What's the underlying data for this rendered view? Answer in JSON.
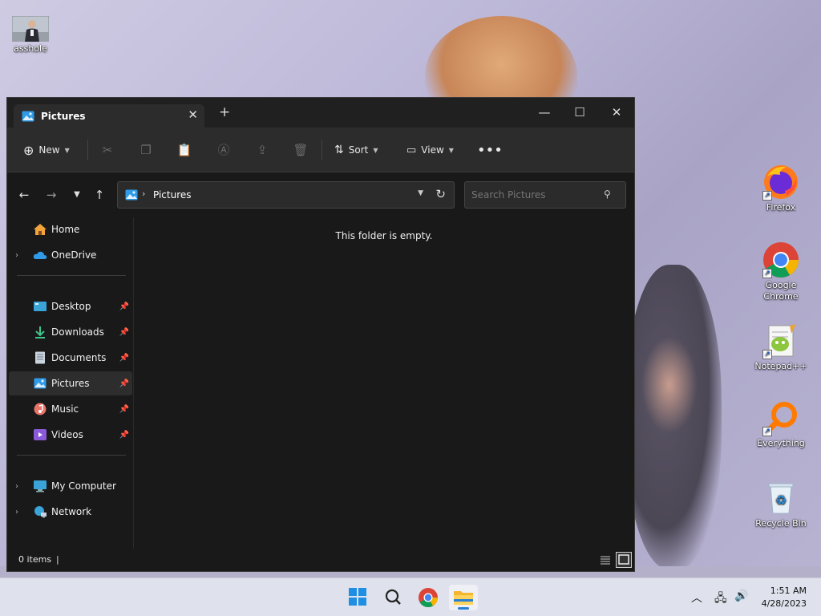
{
  "desktop": {
    "icons": [
      {
        "label": "asshole"
      },
      {
        "label": "Firefox"
      },
      {
        "label": "Google Chrome"
      },
      {
        "label": "Notepad++"
      },
      {
        "label": "Everything"
      },
      {
        "label": "Recycle Bin"
      }
    ]
  },
  "explorer": {
    "tab_title": "Pictures",
    "toolbar": {
      "new_label": "New",
      "sort_label": "Sort",
      "view_label": "View"
    },
    "address": {
      "path": "Pictures"
    },
    "search": {
      "placeholder": "Search Pictures"
    },
    "sidebar": {
      "items": [
        {
          "label": "Home"
        },
        {
          "label": "OneDrive"
        },
        {
          "label": "Desktop"
        },
        {
          "label": "Downloads"
        },
        {
          "label": "Documents"
        },
        {
          "label": "Pictures"
        },
        {
          "label": "Music"
        },
        {
          "label": "Videos"
        },
        {
          "label": "My Computer"
        },
        {
          "label": "Network"
        }
      ]
    },
    "content": {
      "empty_message": "This folder is empty."
    },
    "status": {
      "item_count": "0 items"
    }
  },
  "taskbar": {
    "time": "1:51 AM",
    "date": "4/28/2023"
  },
  "colors": {
    "accent": "#2a7fd4",
    "window_bg": "#191919",
    "toolbar_bg": "#2c2c2c",
    "taskbar_bg": "#dfe2ec"
  }
}
